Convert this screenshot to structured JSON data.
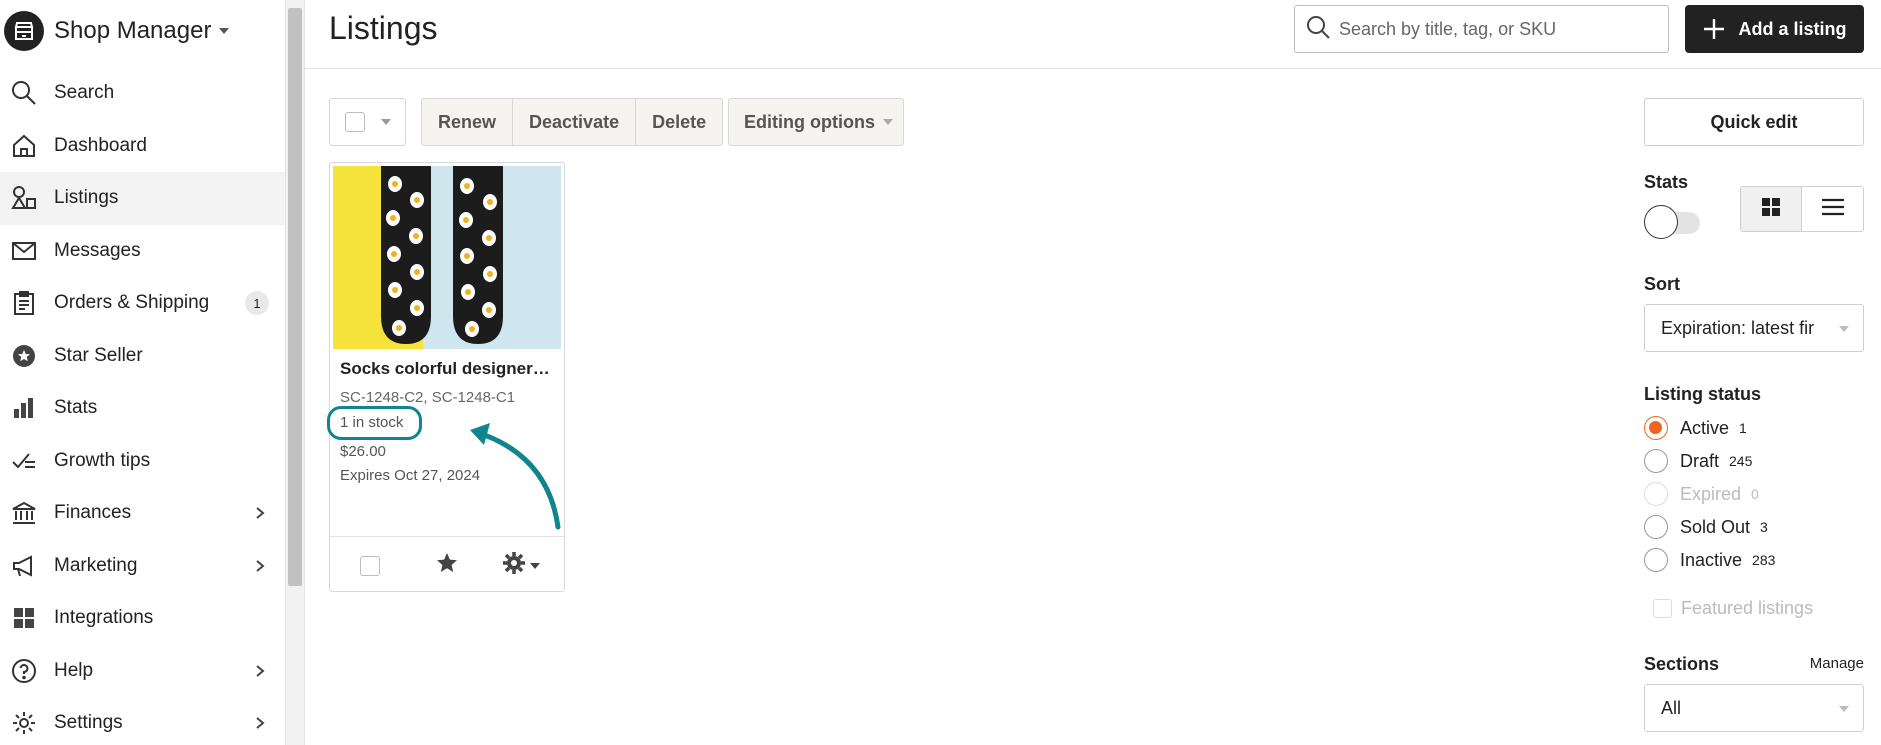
{
  "sidebar": {
    "title": "Shop Manager",
    "items": [
      {
        "label": "Search",
        "icon": "search-icon"
      },
      {
        "label": "Dashboard",
        "icon": "home-icon"
      },
      {
        "label": "Listings",
        "icon": "listings-icon",
        "active": true
      },
      {
        "label": "Messages",
        "icon": "mail-icon"
      },
      {
        "label": "Orders & Shipping",
        "icon": "clipboard-icon",
        "badge": "1"
      },
      {
        "label": "Star Seller",
        "icon": "star-badge-icon"
      },
      {
        "label": "Stats",
        "icon": "bar-chart-icon"
      },
      {
        "label": "Growth tips",
        "icon": "growth-icon"
      },
      {
        "label": "Finances",
        "icon": "bank-icon",
        "chevron": true
      },
      {
        "label": "Marketing",
        "icon": "megaphone-icon",
        "chevron": true
      },
      {
        "label": "Integrations",
        "icon": "grid-icon"
      },
      {
        "label": "Help",
        "icon": "help-icon",
        "chevron": true
      },
      {
        "label": "Settings",
        "icon": "gear-icon",
        "chevron": true
      }
    ]
  },
  "header": {
    "title": "Listings",
    "search_placeholder": "Search by title, tag, or SKU",
    "add_label": "Add a listing"
  },
  "toolbar": {
    "renew": "Renew",
    "deactivate": "Deactivate",
    "delete": "Delete",
    "editing_options": "Editing options"
  },
  "listing": {
    "title": "Socks colorful designer…",
    "sku": "SC-1248-C2, SC-1248-C1",
    "stock": "1 in stock",
    "price": "$26.00",
    "expires": "Expires Oct 27, 2024"
  },
  "panel": {
    "quick_edit": "Quick edit",
    "stats_label": "Stats",
    "sort_label": "Sort",
    "sort_value": "Expiration: latest fir",
    "status_label": "Listing status",
    "statuses": [
      {
        "label": "Active",
        "count": "1",
        "checked": true
      },
      {
        "label": "Draft",
        "count": "245"
      },
      {
        "label": "Expired",
        "count": "0",
        "disabled": true
      },
      {
        "label": "Sold Out",
        "count": "3"
      },
      {
        "label": "Inactive",
        "count": "283"
      }
    ],
    "featured_label": "Featured listings",
    "sections_label": "Sections",
    "manage_label": "Manage",
    "sections_value": "All"
  },
  "colors": {
    "accent": "#f1641e",
    "annotation": "#11858f",
    "primary_button": "#222222"
  }
}
